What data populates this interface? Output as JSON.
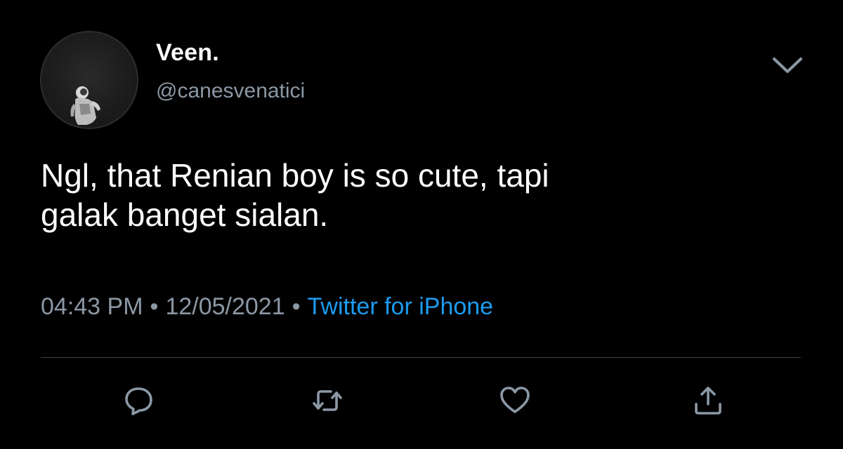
{
  "tweet": {
    "author": {
      "display_name": "Veen.",
      "handle": "@canesvenatici",
      "avatar_icon": "astronaut-avatar"
    },
    "text_lines": [
      "Ngl, that Renian boy is so cute, tapi",
      "galak banget sialan."
    ],
    "meta": {
      "time": "04:43 PM",
      "separator": "•",
      "date": "12/05/2021",
      "source": "Twitter for iPhone"
    },
    "menu_icon": "chevron-down-icon",
    "actions": [
      {
        "name": "reply",
        "icon": "reply-icon"
      },
      {
        "name": "retweet",
        "icon": "retweet-icon"
      },
      {
        "name": "like",
        "icon": "heart-icon"
      },
      {
        "name": "share",
        "icon": "share-icon"
      }
    ]
  },
  "colors": {
    "background": "#000000",
    "primary_text": "#ffffff",
    "secondary_text": "#8b98a5",
    "link": "#1d9bf0",
    "divider": "#38444d"
  }
}
